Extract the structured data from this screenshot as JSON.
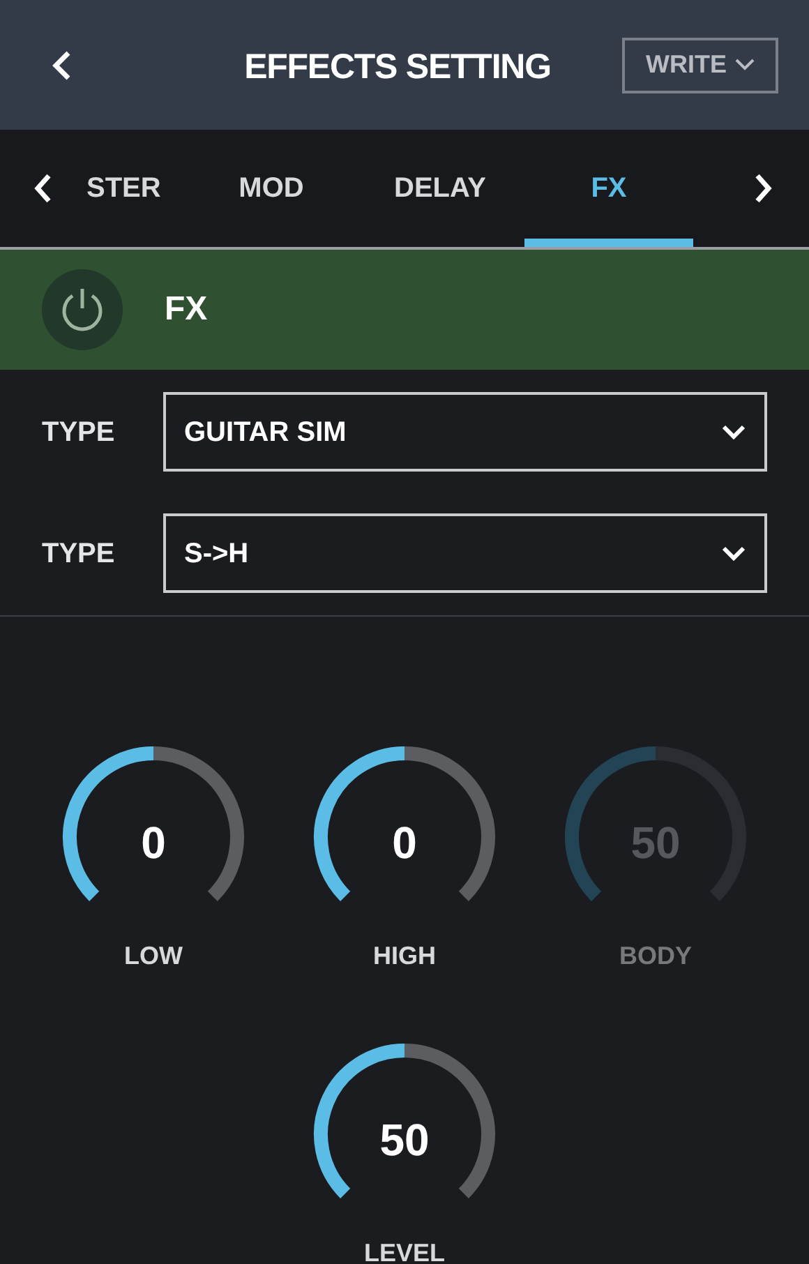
{
  "header": {
    "title": "EFFECTS SETTING",
    "write_button": {
      "label": "WRITE"
    }
  },
  "tabs": [
    {
      "label": "STER",
      "selected": false
    },
    {
      "label": "MOD",
      "selected": false
    },
    {
      "label": "DELAY",
      "selected": false
    },
    {
      "label": "FX",
      "selected": true
    }
  ],
  "effect": {
    "name": "FX",
    "on": true
  },
  "selectors": [
    {
      "label": "TYPE",
      "value": "GUITAR SIM"
    },
    {
      "label": "TYPE",
      "value": "S->H"
    }
  ],
  "knobs": [
    {
      "label": "LOW",
      "value": "0",
      "disabled": false
    },
    {
      "label": "HIGH",
      "value": "0",
      "disabled": false
    },
    {
      "label": "BODY",
      "value": "50",
      "disabled": true
    },
    {
      "label": "LEVEL",
      "value": "50",
      "disabled": false
    }
  ]
}
